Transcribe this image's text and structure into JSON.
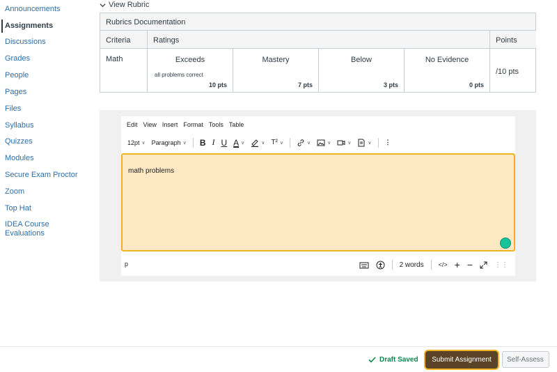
{
  "sidebar": {
    "items": [
      {
        "label": "Announcements"
      },
      {
        "label": "Assignments"
      },
      {
        "label": "Discussions"
      },
      {
        "label": "Grades"
      },
      {
        "label": "People"
      },
      {
        "label": "Pages"
      },
      {
        "label": "Files"
      },
      {
        "label": "Syllabus"
      },
      {
        "label": "Quizzes"
      },
      {
        "label": "Modules"
      },
      {
        "label": "Secure Exam Proctor"
      },
      {
        "label": "Zoom"
      },
      {
        "label": "Top Hat"
      },
      {
        "label": "IDEA Course Evaluations"
      }
    ],
    "active": "Assignments"
  },
  "rubric": {
    "toggle_label": "View Rubric",
    "title": "Rubrics Documentation",
    "headers": {
      "criteria": "Criteria",
      "ratings": "Ratings",
      "points": "Points"
    },
    "criterion": "Math",
    "ratings": [
      {
        "title": "Exceeds",
        "desc": "all problems correct",
        "pts": "10 pts"
      },
      {
        "title": "Mastery",
        "desc": "",
        "pts": "7 pts"
      },
      {
        "title": "Below",
        "desc": "",
        "pts": "3 pts"
      },
      {
        "title": "No Evidence",
        "desc": "",
        "pts": "0 pts"
      }
    ],
    "points_value": "/10 pts"
  },
  "editor": {
    "menu": [
      "Edit",
      "View",
      "Insert",
      "Format",
      "Tools",
      "Table"
    ],
    "font_size": "12pt",
    "block_format": "Paragraph",
    "superscript_label": "T²",
    "content": "math problems",
    "path": "p",
    "word_count": "2 words",
    "html_toggle": "</>"
  },
  "footer": {
    "draft_status": "Draft Saved",
    "submit_label": "Submit Assignment",
    "self_assess_label": "Self-Assess"
  }
}
